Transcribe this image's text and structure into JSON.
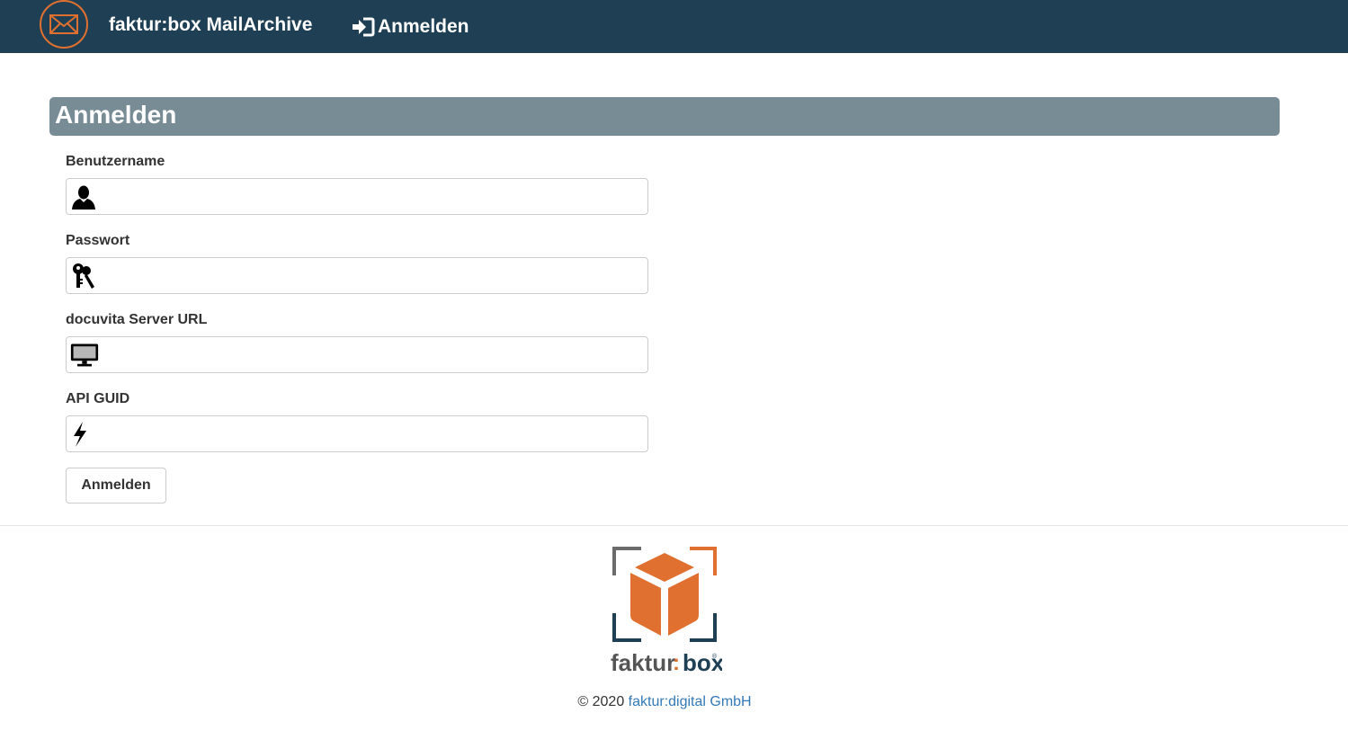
{
  "navbar": {
    "brand": "faktur:box MailArchive",
    "login_label": "Anmelden",
    "logo_icon": "envelope-icon",
    "colors": {
      "background": "#1f4054",
      "accent": "#e07030"
    }
  },
  "login_panel": {
    "title": "Anmelden",
    "fields": [
      {
        "label": "Benutzername",
        "icon": "user-icon",
        "value": "",
        "placeholder": ""
      },
      {
        "label": "Passwort",
        "icon": "keys-icon",
        "value": "",
        "placeholder": ""
      },
      {
        "label": "docuvita Server URL",
        "icon": "monitor-icon",
        "value": "",
        "placeholder": ""
      },
      {
        "label": "API GUID",
        "icon": "lightning-icon",
        "value": "",
        "placeholder": ""
      }
    ],
    "submit_label": "Anmelden",
    "colors": {
      "heading_background": "#788c96"
    }
  },
  "footer": {
    "logo_text_left": "faktur",
    "logo_text_separator": ":",
    "logo_text_right": "box",
    "logo_registered_mark": "®",
    "copyright_prefix": "© 2020",
    "company_link": "faktur:digital GmbH",
    "colors": {
      "logo_orange": "#e07030",
      "logo_dark": "#1f4054",
      "link": "#337ab7"
    }
  }
}
